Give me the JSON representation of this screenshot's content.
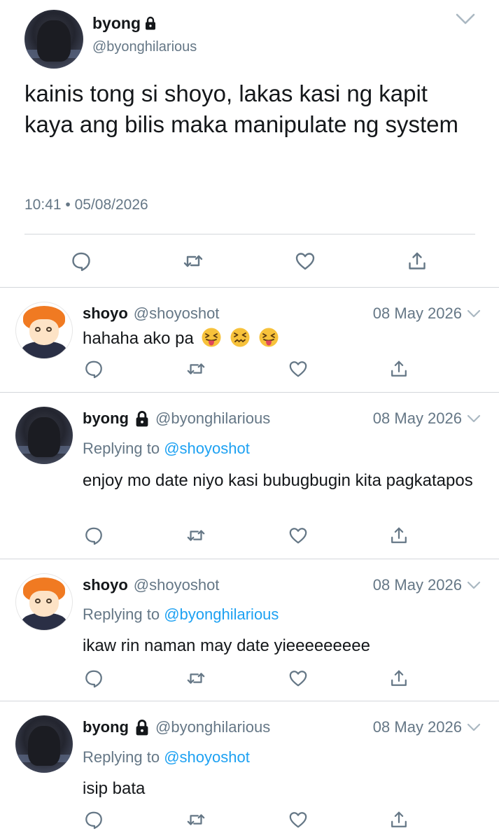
{
  "main_tweet": {
    "name": "byong",
    "handle": "@byonghilarious",
    "text": "kainis tong si shoyo, lakas kasi ng kapit kaya ang bilis maka manipulate ng system",
    "meta": "10:41 • 05/08/2026",
    "icons": [
      "lock-icon",
      "chevron-down-icon",
      "reply-icon",
      "retweet-icon",
      "like-icon",
      "share-icon"
    ]
  },
  "replies": [
    {
      "name": "shoyo",
      "handle": "@shoyoshot",
      "date": "08 May 2026",
      "locked": false,
      "replying_label": "",
      "replying_to": "",
      "text": "hahaha ako pa",
      "emojis": [
        "squinting-face-with-tongue",
        "confounded-face",
        "squinting-face-with-tongue"
      ]
    },
    {
      "name": "byong",
      "handle": "@byonghilarious",
      "date": "08 May 2026",
      "locked": true,
      "replying_label": "Replying to",
      "replying_to": "@shoyoshot",
      "text": "enjoy mo date niyo kasi bubugbugin kita pagkatapos"
    },
    {
      "name": "shoyo",
      "handle": "@shoyoshot",
      "date": "08 May 2026",
      "locked": false,
      "replying_label": "Replying to",
      "replying_to": "@byonghilarious",
      "text": "ikaw rin naman may date yieeeeeeeee"
    },
    {
      "name": "byong",
      "handle": "@byonghilarious",
      "date": "08 May 2026",
      "locked": true,
      "replying_label": "Replying to",
      "replying_to": "@shoyoshot",
      "text": "isip bata"
    }
  ],
  "colors": {
    "text": "#14171a",
    "secondary": "#657786",
    "mention": "#1da1f2",
    "divider": "#d3d7db",
    "emoji_yellow": "#f7c23b"
  }
}
